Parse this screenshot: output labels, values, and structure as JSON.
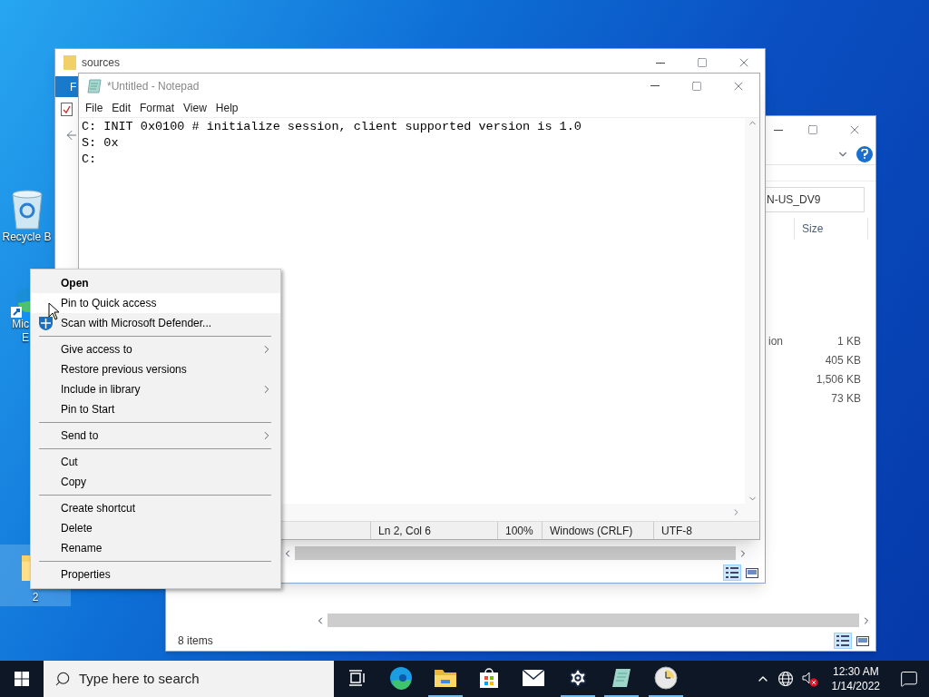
{
  "desktop_icons": [
    {
      "kind": "recycle",
      "lines": [
        "Recycle B"
      ],
      "selected": false
    },
    {
      "kind": "edge",
      "lines": [
        "Mic",
        "E"
      ],
      "selected": false
    },
    {
      "kind": "folder",
      "lines": [
        "2"
      ],
      "selected": true
    }
  ],
  "explorer_back": {
    "search_value": "N-US_DV9",
    "columns": [
      "Size"
    ],
    "rows": [
      {
        "column_1": "ion",
        "size": "1 KB"
      },
      {
        "size": "405 KB"
      },
      {
        "size": "1,506 KB"
      },
      {
        "size": "73 KB"
      }
    ],
    "status": "8 items",
    "details_view_selected": true
  },
  "explorer_front": {
    "title": "sources",
    "ribbon_tab": "F",
    "details_view_selected": true
  },
  "notepad": {
    "title": "*Untitled - Notepad",
    "menu": [
      "File",
      "Edit",
      "Format",
      "View",
      "Help"
    ],
    "lines": [
      "C: INIT 0x0100 # initialize session, client supported version is 1.0",
      "S: 0x",
      "C:"
    ],
    "status": [
      "Ln 2, Col 6",
      "100%",
      "Windows (CRLF)",
      "UTF-8"
    ]
  },
  "context_menu": [
    {
      "kind": "item",
      "label": "Open",
      "default": true,
      "submenu": false,
      "selected": false
    },
    {
      "kind": "item",
      "label": "Pin to Quick access",
      "default": false,
      "submenu": false,
      "selected": true
    },
    {
      "kind": "shield_item",
      "label": "Scan with Microsoft Defender...",
      "default": false,
      "submenu": false,
      "selected": false
    },
    {
      "kind": "separator"
    },
    {
      "kind": "item",
      "label": "Give access to",
      "default": false,
      "submenu": true,
      "selected": false
    },
    {
      "kind": "item",
      "label": "Restore previous versions",
      "default": false,
      "submenu": false,
      "selected": false
    },
    {
      "kind": "item",
      "label": "Include in library",
      "default": false,
      "submenu": true,
      "selected": false
    },
    {
      "kind": "item",
      "label": "Pin to Start",
      "default": false,
      "submenu": false,
      "selected": false
    },
    {
      "kind": "separator"
    },
    {
      "kind": "item",
      "label": "Send to",
      "default": false,
      "submenu": true,
      "selected": false
    },
    {
      "kind": "separator"
    },
    {
      "kind": "item",
      "label": "Cut",
      "default": false,
      "submenu": false,
      "selected": false
    },
    {
      "kind": "item",
      "label": "Copy",
      "default": false,
      "submenu": false,
      "selected": false
    },
    {
      "kind": "separator"
    },
    {
      "kind": "item",
      "label": "Create shortcut",
      "default": false,
      "submenu": false,
      "selected": false
    },
    {
      "kind": "item",
      "label": "Delete",
      "default": false,
      "submenu": false,
      "selected": false
    },
    {
      "kind": "item",
      "label": "Rename",
      "default": false,
      "submenu": false,
      "selected": false
    },
    {
      "kind": "separator"
    },
    {
      "kind": "item",
      "label": "Properties",
      "default": false,
      "submenu": false,
      "selected": false
    }
  ],
  "taskbar": {
    "search_placeholder": "Type here to search",
    "apps": [
      {
        "kind": "task_view",
        "running": false
      },
      {
        "kind": "edge",
        "running": false
      },
      {
        "kind": "explorer",
        "running": true
      },
      {
        "kind": "store",
        "running": false
      },
      {
        "kind": "mail",
        "running": false
      },
      {
        "kind": "settings",
        "running": true
      },
      {
        "kind": "notepad",
        "running": true
      },
      {
        "kind": "clock",
        "running": true
      }
    ],
    "time": "12:30 AM",
    "date": "1/14/2022"
  }
}
